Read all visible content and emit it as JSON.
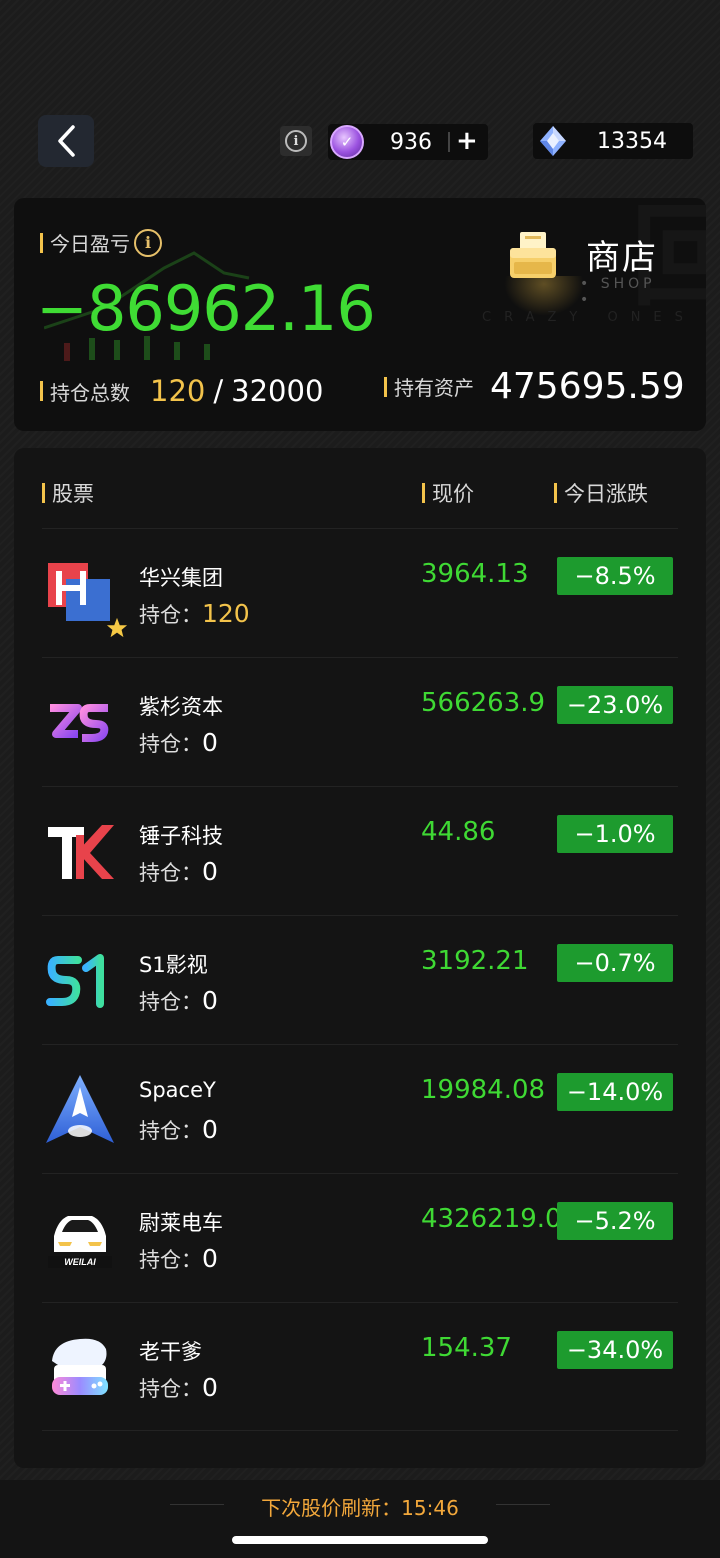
{
  "header": {
    "coins": "936",
    "coins_plus": "+",
    "gems": "13354"
  },
  "summary": {
    "pl_label": "今日盈亏",
    "pl_value": "−86962.16",
    "shop_label": "商店",
    "shop_sub": "• SHOP •",
    "watermark": "CRAZY ONES",
    "holdings_label": "持仓总数",
    "holdings_current": "120",
    "holdings_sep": "/",
    "holdings_max": "32000",
    "assets_label": "持有资产",
    "assets_value": "475695.59"
  },
  "table": {
    "col_stock": "股票",
    "col_price": "现价",
    "col_change": "今日涨跌",
    "hold_label": "持仓：",
    "rows": [
      {
        "name": "华兴集团",
        "hold": "120",
        "price": "3964.13",
        "change": "−8.5%",
        "logo": "huaxing-logo"
      },
      {
        "name": "紫杉资本",
        "hold": "0",
        "price": "566263.9",
        "change": "−23.0%",
        "logo": "zishan-logo"
      },
      {
        "name": "锤子科技",
        "hold": "0",
        "price": "44.86",
        "change": "−1.0%",
        "logo": "hammer-tech-logo"
      },
      {
        "name": "S1影视",
        "hold": "0",
        "price": "3192.21",
        "change": "−0.7%",
        "logo": "s1-film-logo"
      },
      {
        "name": "SpaceY",
        "hold": "0",
        "price": "19984.08",
        "change": "−14.0%",
        "logo": "spacey-rocket-logo"
      },
      {
        "name": "尉莱电车",
        "hold": "0",
        "price": "4326219.0",
        "change": "−5.2%",
        "logo": "weilai-car-logo",
        "logo_text": "WEILAI"
      },
      {
        "name": "老干爹",
        "hold": "0",
        "price": "154.37",
        "change": "−34.0%",
        "logo": "laogandie-logo"
      }
    ]
  },
  "footer": {
    "refresh_text": "下次股价刷新：15:46"
  },
  "colors": {
    "gain_loss_green": "#3fdc34",
    "badge_green": "#1d9b2e",
    "accent_gold": "#f3c34b"
  }
}
